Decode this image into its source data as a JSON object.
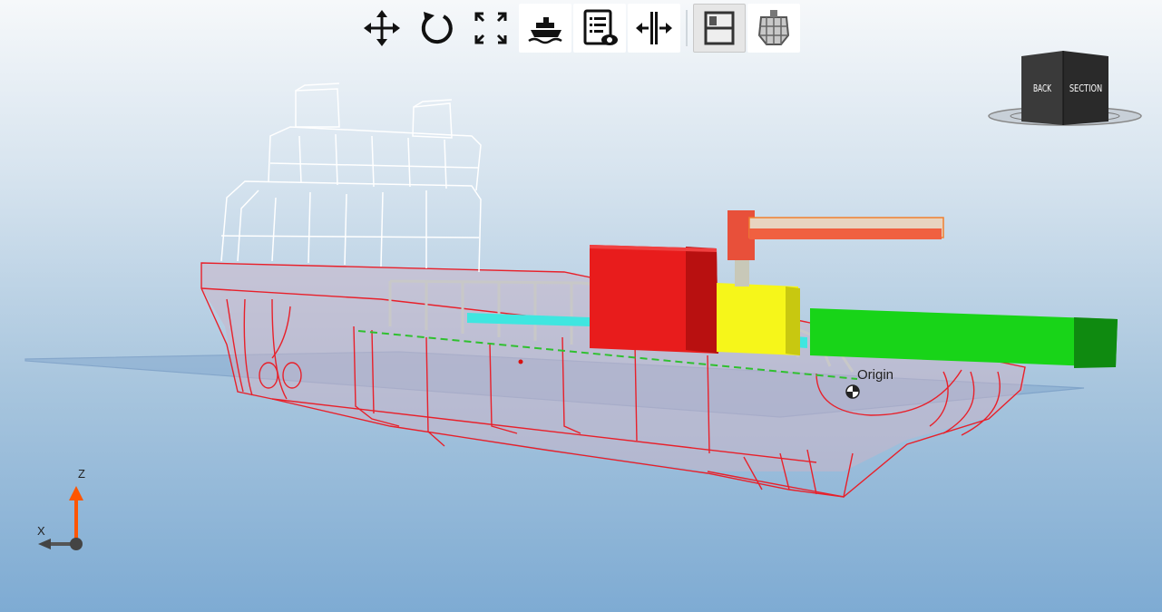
{
  "viewport": {
    "origin_label": "Origin",
    "axis_labels": {
      "z": "Z",
      "x": "X"
    }
  },
  "toolbar": {
    "buttons": [
      {
        "name": "pan",
        "icon": "move-arrows-icon"
      },
      {
        "name": "rotate",
        "icon": "rotate-icon"
      },
      {
        "name": "fit-view",
        "icon": "expand-corners-icon"
      },
      {
        "name": "vessel-view",
        "icon": "ship-icon"
      },
      {
        "name": "report-view",
        "icon": "document-eye-icon"
      },
      {
        "name": "section-cut",
        "icon": "section-split-icon"
      },
      {
        "name": "split-view",
        "icon": "split-panel-icon"
      },
      {
        "name": "shell-view",
        "icon": "hull-shell-icon"
      }
    ]
  },
  "view_cube": {
    "left_face": "BACK",
    "right_face": "SECTION"
  },
  "colors": {
    "hull_lines": "#e8202a",
    "superstructure_lines": "#ffffff",
    "cargo_red": "#e81c1c",
    "cargo_yellow": "#f6f61a",
    "cargo_green": "#18d418",
    "cargo_cyan": "#3fe6e0",
    "crane": "#f06040",
    "waterplane": "#4f7fb8",
    "axis_z": "#ff5500"
  }
}
